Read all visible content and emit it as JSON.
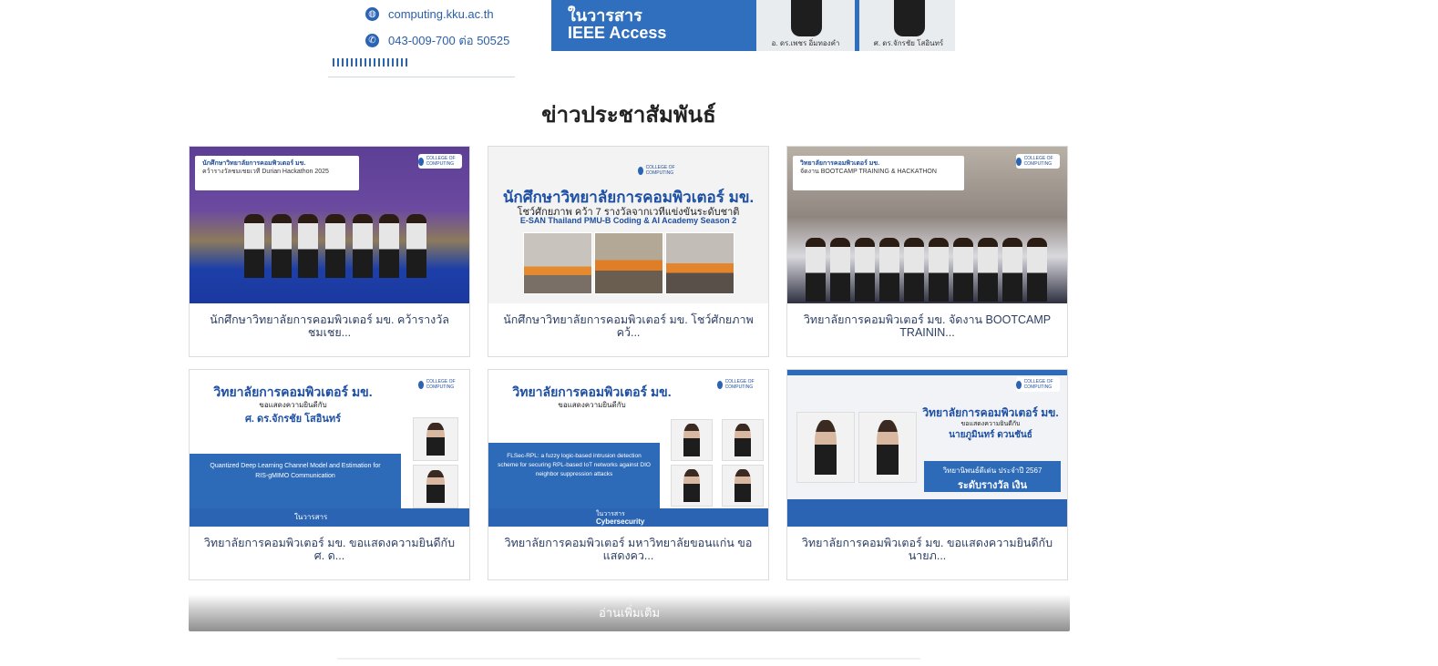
{
  "banner": {
    "website": "computing.kku.ac.th",
    "phone": "043-009-700 ต่อ 50525",
    "journal_line1": "ในวารสาร",
    "journal_line2": "IEEE Access",
    "person1_caption": "อ. ดร.เพชร อิ่มทองคำ",
    "person2_caption": "ศ. ดร.จักรชัย โสอินทร์",
    "colors": {
      "accent": "#2f6fbd"
    }
  },
  "section": {
    "title": "ข่าวประชาสัมพันธ์"
  },
  "cards": [
    {
      "caption": "นักศึกษาวิทยาลัยการคอมพิวเตอร์ มข. คว้ารางวัลชมเชย...",
      "thumb": {
        "header": "นักศึกษาวิทยาลัยการคอมพิวเตอร์ มข.",
        "sub": "คว้ารางวัลชมเชยเวที Durian Hackathon 2025",
        "logo": "COLLEGE OF COMPUTING"
      }
    },
    {
      "caption": "นักศึกษาวิทยาลัยการคอมพิวเตอร์ มข. โชว์ศักยภาพ คว้...",
      "thumb": {
        "header": "นักศึกษาวิทยาลัยการคอมพิวเตอร์ มข.",
        "sub": "โชว์ศักยภาพ คว้า 7 รางวัลจากเวทีแข่งขันระดับชาติ",
        "sub2": "E-SAN Thailand PMU-B Coding & AI Academy Season 2",
        "logo": "COLLEGE OF COMPUTING"
      }
    },
    {
      "caption": "วิทยาลัยการคอมพิวเตอร์ มข. จัดงาน BOOTCAMP TRAININ...",
      "thumb": {
        "header": "วิทยาลัยการคอมพิวเตอร์ มข.",
        "sub": "จัดงาน BOOTCAMP TRAINING & HACKATHON",
        "logo": "COLLEGE OF COMPUTING"
      }
    },
    {
      "caption": "วิทยาลัยการคอมพิวเตอร์ มข. ขอแสดงความยินดีกับ ศ. ด...",
      "thumb": {
        "header": "วิทยาลัยการคอมพิวเตอร์ มข.",
        "sub": "ขอแสดงความยินดีกับ",
        "name": "ศ. ดร.จักรชัย โสอินทร์",
        "paper": "Quantized Deep Learning Channel Model and Estimation for RIS-gMIMO Communication",
        "journal": "ในวารสาร",
        "logo": "COLLEGE OF COMPUTING"
      }
    },
    {
      "caption": "วิทยาลัยการคอมพิวเตอร์ มหาวิทยาลัยขอนแก่น ขอแสดงคว...",
      "thumb": {
        "header": "วิทยาลัยการคอมพิวเตอร์ มข.",
        "sub": "ขอแสดงความยินดีกับ",
        "paper": "FLSec-RPL: a fuzzy logic-based intrusion detection scheme for securing RPL-based IoT networks against DIO neighbor suppression attacks",
        "journal": "ในวารสาร",
        "journal2": "Cybersecurity",
        "logo": "COLLEGE OF COMPUTING"
      }
    },
    {
      "caption": "วิทยาลัยการคอมพิวเตอร์ มข. ขอแสดงความยินดีกับ นายภ...",
      "thumb": {
        "header": "วิทยาลัยการคอมพิวเตอร์ มข.",
        "sub": "ขอแสดงความยินดีกับ",
        "name": "นายภูมินทร์ ดวนชันธ์",
        "award": "วิทยานิพนธ์ดีเด่น ประจำปี 2567",
        "award2": "ระดับรางวัล เงิน",
        "logo": "COLLEGE OF COMPUTING"
      }
    }
  ],
  "more_button": {
    "label": "อ่านเพิ่มเติม"
  }
}
